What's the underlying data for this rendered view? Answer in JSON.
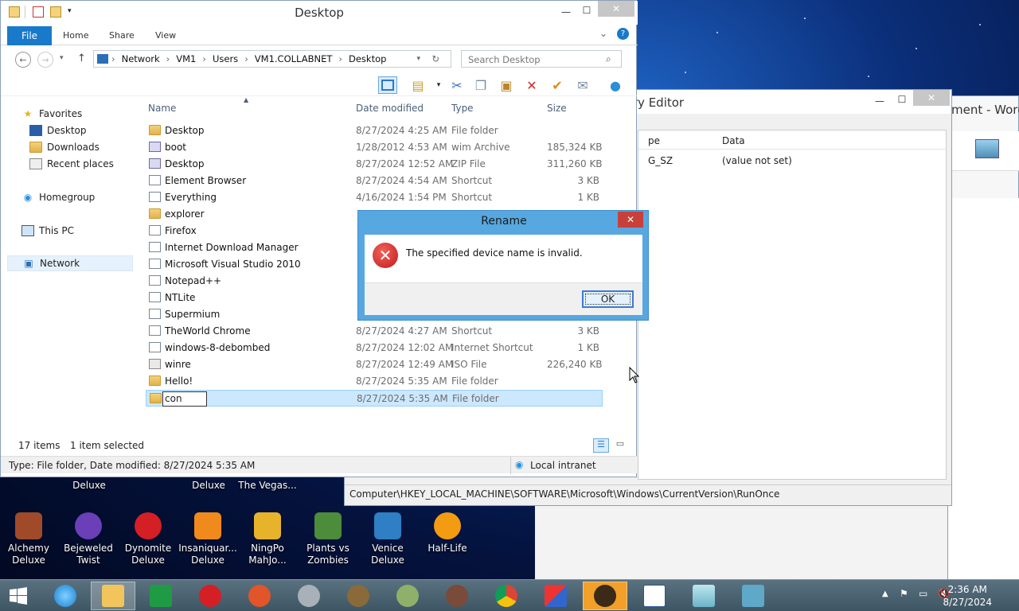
{
  "explorer": {
    "title": "Desktop",
    "ribbon": {
      "file": "File",
      "tabs": [
        "Home",
        "Share",
        "View"
      ]
    },
    "address": [
      "Network",
      "VM1",
      "Users",
      "VM1.COLLABNET",
      "Desktop"
    ],
    "search_placeholder": "Search Desktop",
    "nav": {
      "favorites": "Favorites",
      "desktop": "Desktop",
      "downloads": "Downloads",
      "recent": "Recent places",
      "homegroup": "Homegroup",
      "thispc": "This PC",
      "network": "Network"
    },
    "columns": {
      "name": "Name",
      "date": "Date modified",
      "type": "Type",
      "size": "Size"
    },
    "files": [
      {
        "name": "Desktop",
        "date": "8/27/2024 4:25 AM",
        "type": "File folder",
        "size": "",
        "kind": "folder"
      },
      {
        "name": "boot",
        "date": "1/28/2012 4:53 AM",
        "type": "wim Archive",
        "size": "185,324 KB",
        "kind": "archive"
      },
      {
        "name": "Desktop",
        "date": "8/27/2024 12:52 AM",
        "type": "ZIP File",
        "size": "311,260 KB",
        "kind": "archive"
      },
      {
        "name": "Element Browser",
        "date": "8/27/2024 4:54 AM",
        "type": "Shortcut",
        "size": "3 KB",
        "kind": "shortcut"
      },
      {
        "name": "Everything",
        "date": "4/16/2024 1:54 PM",
        "type": "Shortcut",
        "size": "1 KB",
        "kind": "shortcut"
      },
      {
        "name": "explorer",
        "date": "",
        "type": "",
        "size": "",
        "kind": "folder"
      },
      {
        "name": "Firefox",
        "date": "",
        "type": "",
        "size": "",
        "kind": "shortcut"
      },
      {
        "name": "Internet Download Manager",
        "date": "",
        "type": "",
        "size": "",
        "kind": "shortcut"
      },
      {
        "name": "Microsoft Visual Studio 2010",
        "date": "",
        "type": "",
        "size": "",
        "kind": "shortcut"
      },
      {
        "name": "Notepad++",
        "date": "",
        "type": "",
        "size": "",
        "kind": "shortcut"
      },
      {
        "name": "NTLite",
        "date": "",
        "type": "",
        "size": "",
        "kind": "shortcut"
      },
      {
        "name": "Supermium",
        "date": "",
        "type": "",
        "size": "",
        "kind": "shortcut"
      },
      {
        "name": "TheWorld Chrome",
        "date": "8/27/2024 4:27 AM",
        "type": "Shortcut",
        "size": "3 KB",
        "kind": "shortcut"
      },
      {
        "name": "windows-8-debombed",
        "date": "8/27/2024 12:02 AM",
        "type": "Internet Shortcut",
        "size": "1 KB",
        "kind": "shortcut"
      },
      {
        "name": "winre",
        "date": "8/27/2024 12:49 AM",
        "type": "ISO File",
        "size": "226,240 KB",
        "kind": "iso"
      },
      {
        "name": "Hello!",
        "date": "8/27/2024 5:35 AM",
        "type": "File folder",
        "size": "",
        "kind": "folder"
      }
    ],
    "renaming": {
      "value": "con",
      "date": "8/27/2024 5:35 AM",
      "type": "File folder"
    },
    "status": {
      "items": "17 items",
      "selected": "1 item selected"
    },
    "details": {
      "text": "Type: File folder, Date modified: 8/27/2024 5:35 AM",
      "zone": "Local intranet"
    }
  },
  "dialog": {
    "title": "Rename",
    "message": "The specified device name is invalid.",
    "ok": "OK",
    "close": "✕"
  },
  "regedit": {
    "title": "try Editor",
    "col_type": "pe",
    "col_data": "Data",
    "row_type": "G_SZ",
    "row_data": "(value not set)",
    "status": "Computer\\HKEY_LOCAL_MACHINE\\SOFTWARE\\Microsoft\\Windows\\CurrentVersion\\RunOnce"
  },
  "word": {
    "title": "ment - Word"
  },
  "desktop": {
    "top_labels": [
      "Deluxe",
      "Deluxe",
      "The Vegas..."
    ],
    "icons": [
      {
        "label": "Alchemy Deluxe"
      },
      {
        "label": "Bejeweled Twist"
      },
      {
        "label": "Dynomite Deluxe"
      },
      {
        "label": "Insaniquar... Deluxe"
      },
      {
        "label": "NingPo MahJo..."
      },
      {
        "label": "Plants vs Zombies"
      },
      {
        "label": "Venice Deluxe"
      },
      {
        "label": "Half-Life"
      }
    ]
  },
  "taskbar": {
    "time": "2:36 AM",
    "date": "8/27/2024"
  }
}
